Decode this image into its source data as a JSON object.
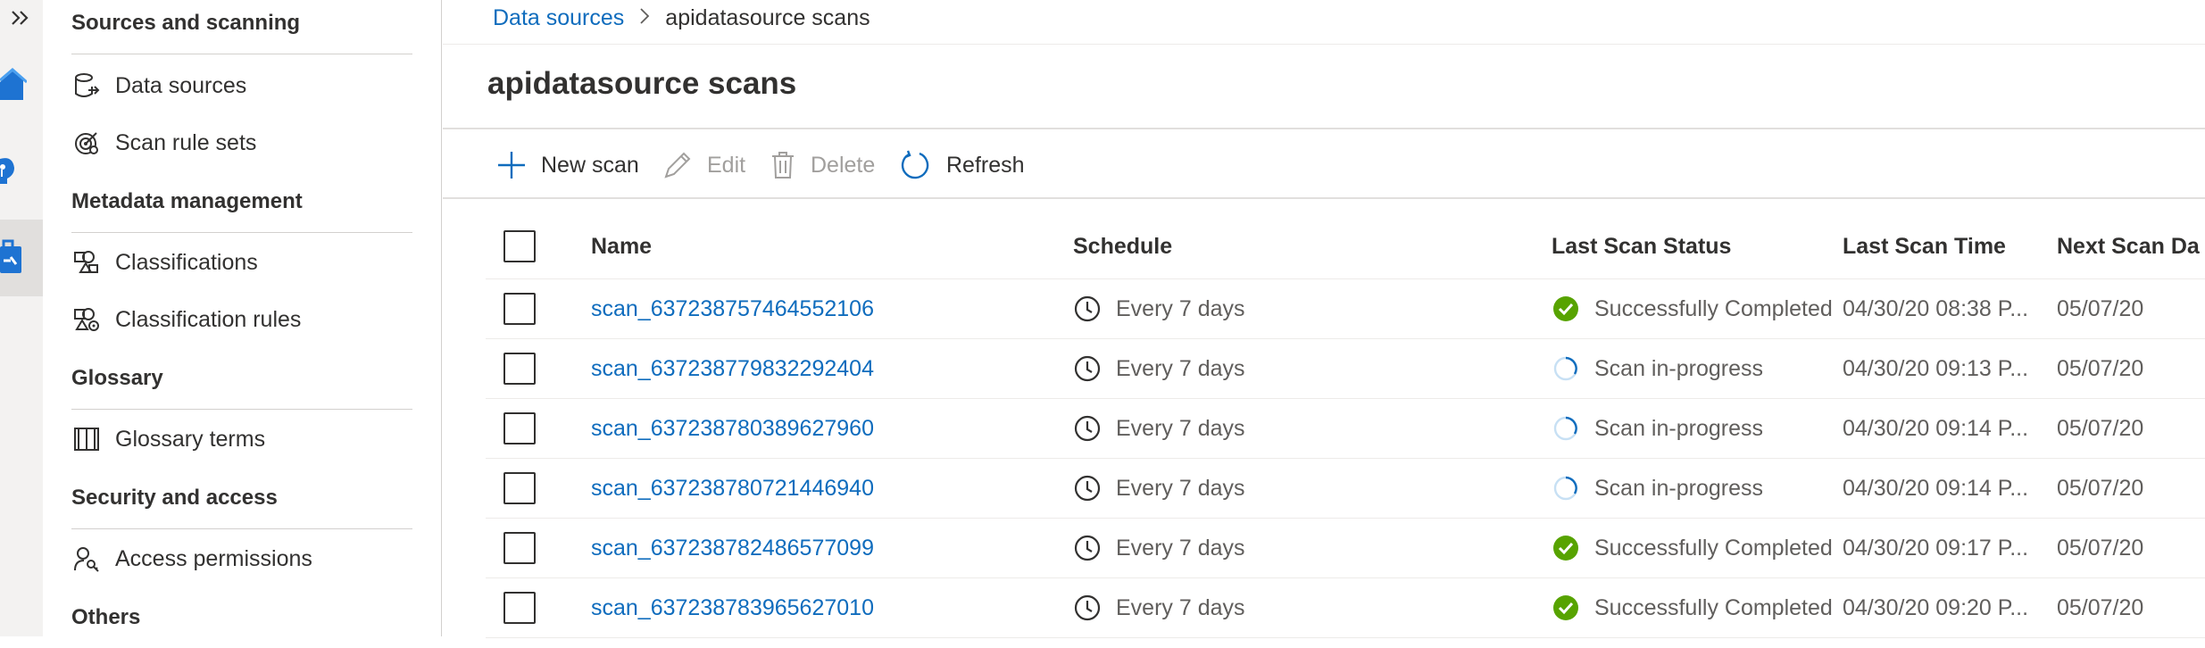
{
  "nav": {
    "groups": [
      {
        "heading": "Sources and scanning",
        "items": [
          {
            "label": "Data sources",
            "icon": "data-source-icon"
          },
          {
            "label": "Scan rule sets",
            "icon": "scan-rule-icon"
          }
        ]
      },
      {
        "heading": "Metadata management",
        "items": [
          {
            "label": "Classifications",
            "icon": "classification-icon"
          },
          {
            "label": "Classification rules",
            "icon": "classification-rule-icon"
          }
        ]
      },
      {
        "heading": "Glossary",
        "items": [
          {
            "label": "Glossary terms",
            "icon": "book-icon"
          }
        ]
      },
      {
        "heading": "Security and access",
        "items": [
          {
            "label": "Access permissions",
            "icon": "person-key-icon"
          }
        ]
      },
      {
        "heading": "Others",
        "items": []
      }
    ]
  },
  "breadcrumb": {
    "parent": "Data sources",
    "current": "apidatasource scans"
  },
  "page_title": "apidatasource scans",
  "toolbar": {
    "new_scan": "New scan",
    "edit": "Edit",
    "delete": "Delete",
    "refresh": "Refresh"
  },
  "table": {
    "columns": [
      "Name",
      "Schedule",
      "Last Scan Status",
      "Last Scan Time",
      "Next Scan Da"
    ],
    "rows": [
      {
        "name": "scan_637238757464552106",
        "schedule": "Every 7 days",
        "status": "Successfully Completed",
        "status_kind": "success",
        "last_time": "04/30/20 08:38 P...",
        "next": "05/07/20"
      },
      {
        "name": "scan_637238779832292404",
        "schedule": "Every 7 days",
        "status": "Scan in-progress",
        "status_kind": "progress",
        "last_time": "04/30/20 09:13 P...",
        "next": "05/07/20"
      },
      {
        "name": "scan_637238780389627960",
        "schedule": "Every 7 days",
        "status": "Scan in-progress",
        "status_kind": "progress",
        "last_time": "04/30/20 09:14 P...",
        "next": "05/07/20"
      },
      {
        "name": "scan_637238780721446940",
        "schedule": "Every 7 days",
        "status": "Scan in-progress",
        "status_kind": "progress",
        "last_time": "04/30/20 09:14 P...",
        "next": "05/07/20"
      },
      {
        "name": "scan_637238782486577099",
        "schedule": "Every 7 days",
        "status": "Successfully Completed",
        "status_kind": "success",
        "last_time": "04/30/20 09:17 P...",
        "next": "05/07/20"
      },
      {
        "name": "scan_637238783965627010",
        "schedule": "Every 7 days",
        "status": "Successfully Completed",
        "status_kind": "success",
        "last_time": "04/30/20 09:20 P...",
        "next": "05/07/20"
      }
    ]
  },
  "colors": {
    "accent": "#0f6cbd",
    "success": "#57a300",
    "disabled": "#a19f9d",
    "text": "#323130"
  }
}
